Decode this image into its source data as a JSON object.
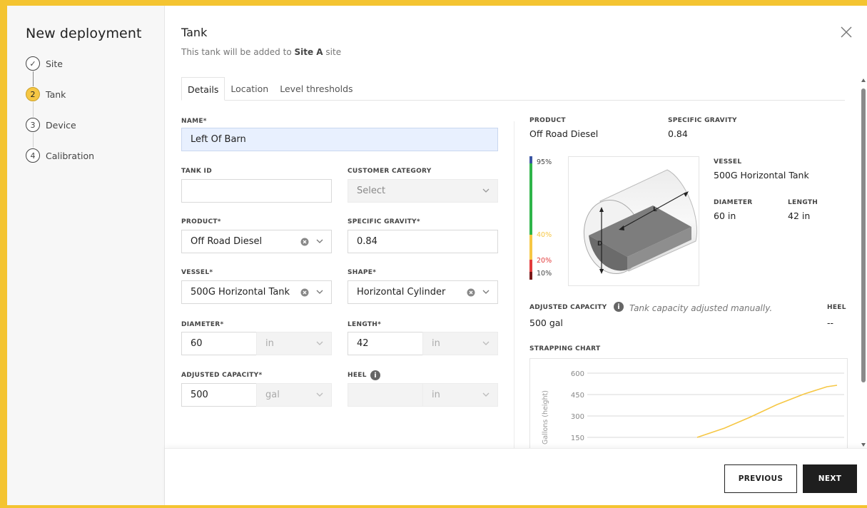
{
  "sidebar": {
    "title": "New deployment",
    "steps": [
      {
        "number": "✓",
        "label": "Site"
      },
      {
        "number": "2",
        "label": "Tank"
      },
      {
        "number": "3",
        "label": "Device"
      },
      {
        "number": "4",
        "label": "Calibration"
      }
    ]
  },
  "header": {
    "title": "Tank",
    "subtitle_prefix": "This tank will be added to ",
    "subtitle_site": "Site A",
    "subtitle_suffix": " site"
  },
  "tabs": [
    {
      "label": "Details",
      "active": true
    },
    {
      "label": "Location",
      "active": false
    },
    {
      "label": "Level thresholds",
      "active": false
    }
  ],
  "form": {
    "name_label": "NAME*",
    "name_value": "Left Of Barn",
    "tank_id_label": "TANK ID",
    "tank_id_value": "",
    "customer_category_label": "CUSTOMER CATEGORY",
    "customer_category_placeholder": "Select",
    "product_label": "PRODUCT*",
    "product_value": "Off Road Diesel",
    "specific_gravity_label": "SPECIFIC GRAVITY*",
    "specific_gravity_value": "0.84",
    "vessel_label": "VESSEL*",
    "vessel_value": "500G Horizontal Tank",
    "shape_label": "SHAPE*",
    "shape_value": "Horizontal Cylinder",
    "diameter_label": "DIAMETER*",
    "diameter_value": "60",
    "diameter_unit": "in",
    "length_label": "LENGTH*",
    "length_value": "42",
    "length_unit": "in",
    "adjusted_capacity_label": "ADJUSTED CAPACITY*",
    "adjusted_capacity_value": "500",
    "adjusted_capacity_unit": "gal",
    "heel_label": "HEEL",
    "heel_value": "",
    "heel_unit": "in"
  },
  "summary": {
    "product_label": "PRODUCT",
    "product_value": "Off Road Diesel",
    "specific_gravity_label": "SPECIFIC GRAVITY",
    "specific_gravity_value": "0.84",
    "vessel_label": "VESSEL",
    "vessel_value": "500G Horizontal Tank",
    "diameter_label": "DIAMETER",
    "diameter_value": "60 in",
    "length_label": "LENGTH",
    "length_value": "42 in",
    "adjusted_capacity_label": "ADJUSTED CAPACITY",
    "adjusted_capacity_value": "500 gal",
    "capacity_note": "Tank capacity adjusted manually.",
    "heel_label": "HEEL",
    "heel_value": "--",
    "strapping_chart_label": "STRAPPING CHART",
    "tank_diagram_d": "D",
    "tank_diagram_l": "L"
  },
  "gauge": {
    "levels": [
      {
        "label": "95%",
        "color": "#3a55a3"
      },
      {
        "label": "40%",
        "color": "#f6c744"
      },
      {
        "label": "20%",
        "color": "#e23b3b"
      },
      {
        "label": "10%",
        "color": "#7a1a1a"
      }
    ],
    "bar_colors": {
      "top": "#3a55a3",
      "green": "#2fb54a",
      "yellow": "#f6c744",
      "red": "#e23b3b",
      "dark": "#7a1a1a"
    }
  },
  "chart_data": {
    "type": "line",
    "title": "",
    "xlabel": "",
    "ylabel": "Gallons (height)",
    "yticks": [
      600,
      450,
      300,
      150
    ],
    "ylim": [
      0,
      600
    ],
    "series": [
      {
        "color": "#f6c744",
        "x": [
          0.44,
          0.55,
          0.65,
          0.76,
          0.87,
          0.96,
          1.0
        ],
        "y": [
          150,
          215,
          290,
          380,
          455,
          505,
          515
        ]
      }
    ],
    "xlim": [
      0,
      1
    ]
  },
  "footer": {
    "previous_label": "PREVIOUS",
    "next_label": "NEXT"
  },
  "colors": {
    "accent": "#f6c744",
    "primary_button": "#1e1e1e"
  }
}
